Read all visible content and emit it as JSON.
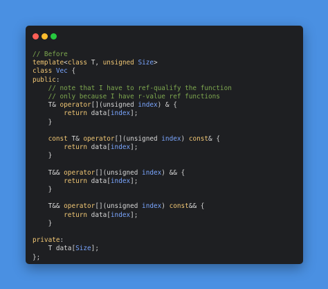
{
  "colors": {
    "background": "#4a90e2",
    "window": "#1e1f22",
    "dot_red": "#ff5f56",
    "dot_yellow": "#ffbd2e",
    "dot_green": "#27c93f",
    "comment": "#7ea84f",
    "keyword": "#f0c674",
    "type": "#7aa6ff",
    "plain": "#d6d6d6"
  },
  "window_controls": [
    "close-dot",
    "minimize-dot",
    "zoom-dot"
  ],
  "code_lines": [
    [
      [
        "comment",
        "// Before"
      ]
    ],
    [
      [
        "keyword",
        "template"
      ],
      [
        "plain",
        "<"
      ],
      [
        "keyword",
        "class"
      ],
      [
        "plain",
        " T, "
      ],
      [
        "keyword",
        "unsigned"
      ],
      [
        "plain",
        " "
      ],
      [
        "type",
        "Size"
      ],
      [
        "plain",
        ">"
      ]
    ],
    [
      [
        "keyword",
        "class"
      ],
      [
        "plain",
        " "
      ],
      [
        "type",
        "Vec"
      ],
      [
        "plain",
        " {"
      ]
    ],
    [
      [
        "keyword",
        "public"
      ],
      [
        "plain",
        ":"
      ]
    ],
    [
      [
        "plain",
        "    "
      ],
      [
        "comment",
        "// note that I have to ref-qualify the function"
      ]
    ],
    [
      [
        "plain",
        "    "
      ],
      [
        "comment",
        "// only because I have r-value ref functions"
      ]
    ],
    [
      [
        "plain",
        "    T& "
      ],
      [
        "keyword",
        "operator"
      ],
      [
        "plain",
        "[](unsigned "
      ],
      [
        "type",
        "index"
      ],
      [
        "plain",
        ") & {"
      ]
    ],
    [
      [
        "plain",
        "        "
      ],
      [
        "keyword",
        "return"
      ],
      [
        "plain",
        " data["
      ],
      [
        "type",
        "index"
      ],
      [
        "plain",
        "];"
      ]
    ],
    [
      [
        "plain",
        "    }"
      ]
    ],
    [
      [
        "plain",
        ""
      ]
    ],
    [
      [
        "plain",
        "    "
      ],
      [
        "keyword",
        "const"
      ],
      [
        "plain",
        " T& "
      ],
      [
        "keyword",
        "operator"
      ],
      [
        "plain",
        "[](unsigned "
      ],
      [
        "type",
        "index"
      ],
      [
        "plain",
        ") "
      ],
      [
        "keyword",
        "const"
      ],
      [
        "plain",
        "& {"
      ]
    ],
    [
      [
        "plain",
        "        "
      ],
      [
        "keyword",
        "return"
      ],
      [
        "plain",
        " data["
      ],
      [
        "type",
        "index"
      ],
      [
        "plain",
        "];"
      ]
    ],
    [
      [
        "plain",
        "    }"
      ]
    ],
    [
      [
        "plain",
        ""
      ]
    ],
    [
      [
        "plain",
        "    T&& "
      ],
      [
        "keyword",
        "operator"
      ],
      [
        "plain",
        "[](unsigned "
      ],
      [
        "type",
        "index"
      ],
      [
        "plain",
        ") && {"
      ]
    ],
    [
      [
        "plain",
        "        "
      ],
      [
        "keyword",
        "return"
      ],
      [
        "plain",
        " data["
      ],
      [
        "type",
        "index"
      ],
      [
        "plain",
        "];"
      ]
    ],
    [
      [
        "plain",
        "    }"
      ]
    ],
    [
      [
        "plain",
        ""
      ]
    ],
    [
      [
        "plain",
        "    T&& "
      ],
      [
        "keyword",
        "operator"
      ],
      [
        "plain",
        "[](unsigned "
      ],
      [
        "type",
        "index"
      ],
      [
        "plain",
        ") "
      ],
      [
        "keyword",
        "const"
      ],
      [
        "plain",
        "&& {"
      ]
    ],
    [
      [
        "plain",
        "        "
      ],
      [
        "keyword",
        "return"
      ],
      [
        "plain",
        " data["
      ],
      [
        "type",
        "index"
      ],
      [
        "plain",
        "];"
      ]
    ],
    [
      [
        "plain",
        "    }"
      ]
    ],
    [
      [
        "plain",
        ""
      ]
    ],
    [
      [
        "keyword",
        "private"
      ],
      [
        "plain",
        ":"
      ]
    ],
    [
      [
        "plain",
        "    T data["
      ],
      [
        "type",
        "Size"
      ],
      [
        "plain",
        "];"
      ]
    ],
    [
      [
        "plain",
        "};"
      ]
    ]
  ]
}
